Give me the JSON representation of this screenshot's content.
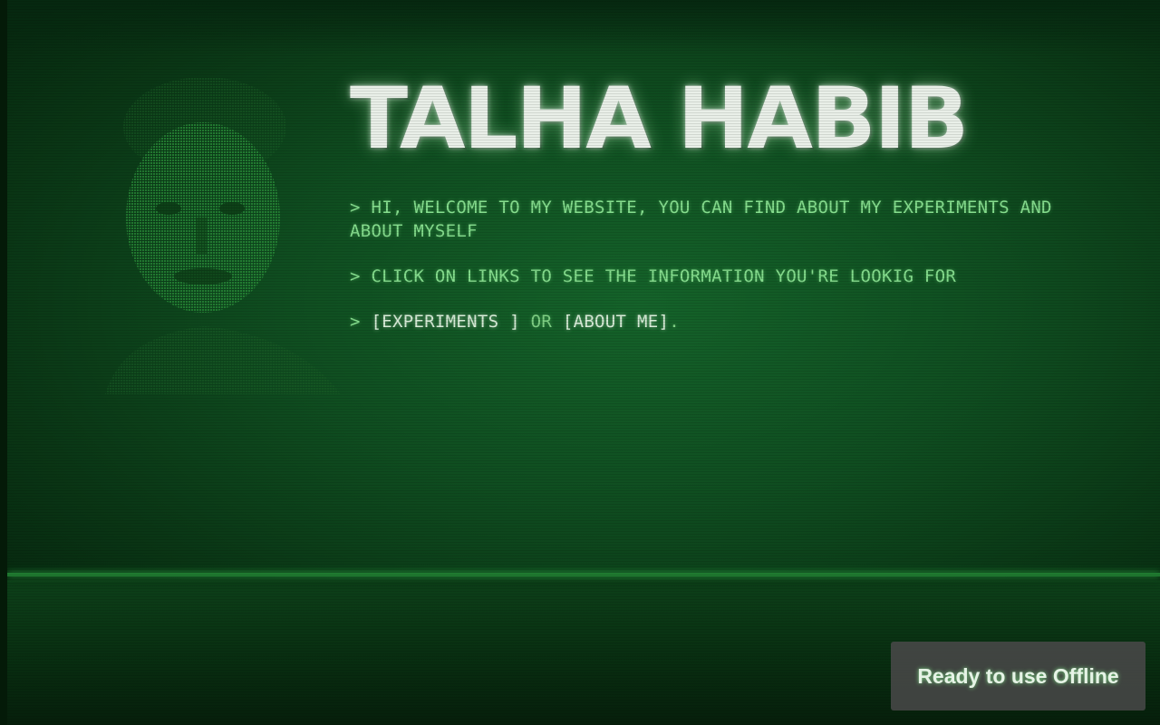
{
  "header": {
    "title": "TALHA HABIB"
  },
  "terminal": {
    "prompt": ">",
    "line1": "HI, WELCOME TO MY WEBSITE, YOU CAN FIND ABOUT MY EXPERIMENTS AND ABOUT MYSELF",
    "line2": "CLICK ON LINKS TO SEE THE INFORMATION YOU'RE LOOKIG FOR",
    "link_experiments": "[EXPERIMENTS ]",
    "or_text": "OR",
    "link_about": "[ABOUT ME]",
    "period": "."
  },
  "toast": {
    "message": "Ready to use Offline"
  },
  "colors": {
    "background": "#0f4d20",
    "terminal_text": "#86de8e",
    "link_text": "#d8ecd8",
    "title_text": "#e9efe8",
    "toast_bg": "#484848"
  }
}
